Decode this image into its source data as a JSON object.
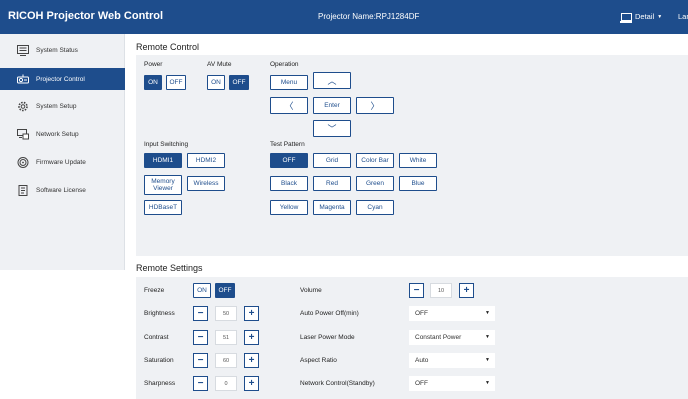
{
  "header": {
    "title": "RICOH Projector Web Control",
    "projector_name": "Projector Name:RPJ1284DF",
    "detail_label": "Detail",
    "detail_caret": "▼",
    "lang_label": "Lar"
  },
  "sidebar": {
    "items": [
      {
        "label": "System Status",
        "icon": "monitor-list-icon"
      },
      {
        "label": "Projector Control",
        "icon": "projector-icon",
        "active": true
      },
      {
        "label": "System Setup",
        "icon": "gear-icon"
      },
      {
        "label": "Network Setup",
        "icon": "network-icon"
      },
      {
        "label": "Firmware Update",
        "icon": "disc-icon"
      },
      {
        "label": "Software License",
        "icon": "document-icon"
      }
    ]
  },
  "remote": {
    "title": "Remote Control",
    "power": {
      "label": "Power",
      "on": "ON",
      "off": "OFF",
      "selected": "ON"
    },
    "av_mute": {
      "label": "AV Mute",
      "on": "ON",
      "off": "OFF",
      "selected": "OFF"
    },
    "operation": {
      "label": "Operation",
      "menu": "Menu",
      "enter": "Enter",
      "up": "︿",
      "down": "﹀",
      "left": "〈",
      "right": "〉"
    },
    "input": {
      "label": "Input Switching",
      "hdmi1": "HDMI1",
      "hdmi2": "HDMI2",
      "memory_viewer_1": "Memory",
      "memory_viewer_2": "Viewer",
      "wireless": "Wireless",
      "hdbaset": "HDBaseT",
      "selected": "HDMI1"
    },
    "test_pattern": {
      "label": "Test Pattern",
      "off": "OFF",
      "grid": "Grid",
      "color_bar": "Color Bar",
      "white": "White",
      "black": "Black",
      "red": "Red",
      "green": "Green",
      "blue": "Blue",
      "yellow": "Yellow",
      "magenta": "Magenta",
      "cyan": "Cyan",
      "selected": "OFF"
    }
  },
  "settings": {
    "title": "Remote Settings",
    "freeze": {
      "label": "Freeze",
      "on": "ON",
      "off": "OFF",
      "selected": "OFF"
    },
    "brightness": {
      "label": "Brightness",
      "value": "50"
    },
    "contrast": {
      "label": "Contrast",
      "value": "51"
    },
    "saturation": {
      "label": "Saturation",
      "value": "60"
    },
    "sharpness": {
      "label": "Sharpness",
      "value": "0"
    },
    "volume": {
      "label": "Volume",
      "value": "10"
    },
    "auto_power_off": {
      "label": "Auto Power Off(min)",
      "value": "OFF"
    },
    "laser_power_mode": {
      "label": "Laser Power Mode",
      "value": "Constant Power"
    },
    "aspect_ratio": {
      "label": "Aspect Ratio",
      "value": "Auto"
    },
    "network_control": {
      "label": "Network Control(Standby)",
      "value": "OFF"
    },
    "minus": "−",
    "plus": "+",
    "caret": "▼"
  },
  "colors": {
    "brand": "#1e4d8c",
    "panel": "#eff1f4"
  }
}
